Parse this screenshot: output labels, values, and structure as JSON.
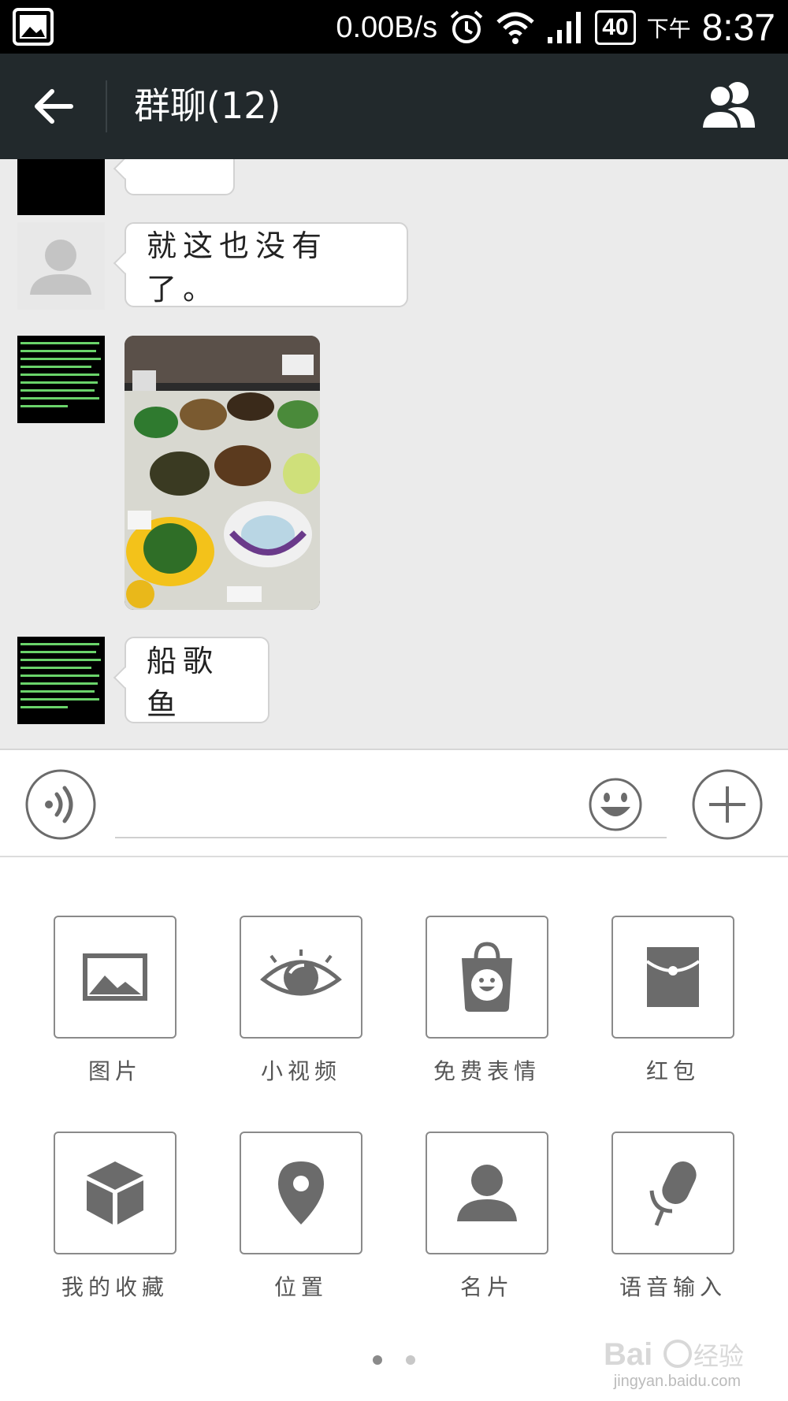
{
  "status_bar": {
    "speed": "0.00B/s",
    "battery": "40",
    "ampm": "下午",
    "time": "8:37",
    "icons": [
      "gallery-icon",
      "alarm-icon",
      "wifi-icon",
      "signal-icon",
      "battery-icon"
    ]
  },
  "header": {
    "title": "群聊(12)",
    "back_icon": "arrow-left-icon",
    "members_icon": "group-members-icon"
  },
  "messages": [
    {
      "type": "text",
      "text": "",
      "partially_visible": true
    },
    {
      "type": "text",
      "avatar": "default-avatar",
      "text": "就这也没有了。"
    },
    {
      "type": "image",
      "avatar": "text-wallpaper-avatar",
      "description_icon": "food-photo"
    },
    {
      "type": "text",
      "avatar": "text-wallpaper-avatar",
      "text": "船歌鱼"
    }
  ],
  "input_bar": {
    "voice_icon": "voice-icon",
    "value": "",
    "emoji_icon": "smiley-icon",
    "plus_icon": "plus-icon"
  },
  "panel": {
    "items": [
      {
        "label": "图片",
        "icon": "image-icon"
      },
      {
        "label": "小视频",
        "icon": "eye-icon"
      },
      {
        "label": "免费表情",
        "icon": "sticker-bag-icon"
      },
      {
        "label": "红包",
        "icon": "red-packet-icon"
      },
      {
        "label": "我的收藏",
        "icon": "box-icon"
      },
      {
        "label": "位置",
        "icon": "location-pin-icon"
      },
      {
        "label": "名片",
        "icon": "person-card-icon"
      },
      {
        "label": "语音输入",
        "icon": "microphone-icon"
      }
    ],
    "page_count": 2,
    "current_page": 1
  },
  "watermark": {
    "logo": "Baidu经验",
    "url": "jingyan.baidu.com"
  },
  "colors": {
    "title_bar": "#22292c",
    "chat_bg": "#ebebeb",
    "icon_gray": "#6b6b6b"
  }
}
